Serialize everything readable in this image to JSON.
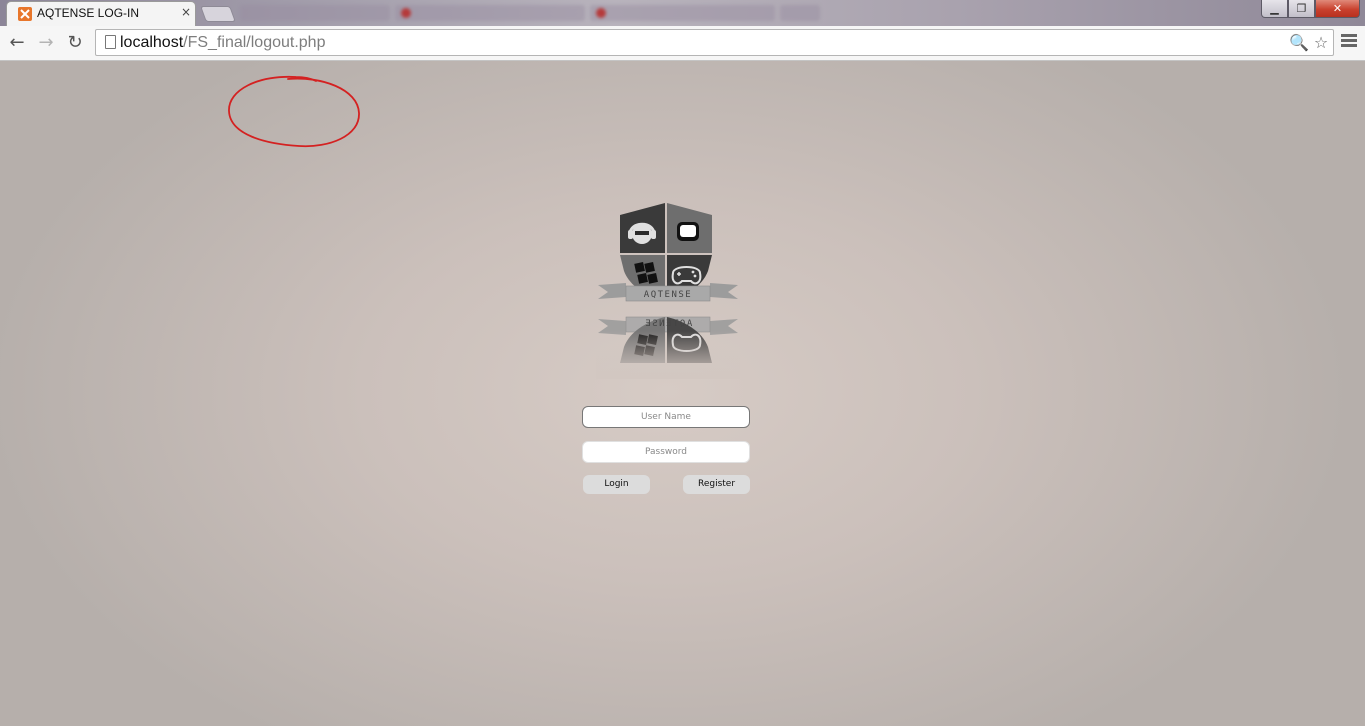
{
  "browser": {
    "tab": {
      "title": "AQTENSE LOG-IN",
      "close_glyph": "×",
      "favicon": "xampp-icon"
    },
    "window_controls": {
      "minimize_glyph": "▁",
      "maximize_glyph": "❐",
      "close_glyph": "✕"
    },
    "nav": {
      "back_glyph": "←",
      "forward_glyph": "→",
      "reload_glyph": "↻"
    },
    "url": {
      "host": "localhost",
      "path": "/FS_final/logout.php"
    },
    "omnibox_icons": {
      "search_glyph": "🔍",
      "star_glyph": "☆"
    }
  },
  "annotation": {
    "color": "#d42121",
    "description": "hand-drawn-circle"
  },
  "login": {
    "logo_text": "AQTENSE",
    "username_placeholder": "User Name",
    "password_placeholder": "Password",
    "login_label": "Login",
    "register_label": "Register"
  },
  "colors": {
    "accent_favicon": "#e8762b",
    "window_close": "#c9412e",
    "background": "#cbc0bb"
  }
}
